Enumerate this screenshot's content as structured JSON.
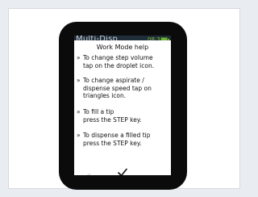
{
  "status_bar": {
    "title": "Multi-Disp",
    "time": "08:30",
    "battery_color": "#6fb43a"
  },
  "dialog": {
    "title": "Work Mode help",
    "items": [
      {
        "bullet": "»",
        "lines": [
          "To change step volume",
          "tap on the droplet icon."
        ]
      },
      {
        "bullet": "»",
        "lines": [
          "To change aspirate /",
          "dispense speed tap on",
          "triangles icon."
        ]
      },
      {
        "bullet": "»",
        "lines": [
          "To fill a tip",
          "press the STEP key."
        ]
      },
      {
        "bullet": "»",
        "lines": [
          "To dispense a filled tip",
          "press the STEP key."
        ]
      }
    ],
    "ok_icon": "checkmark-icon"
  }
}
